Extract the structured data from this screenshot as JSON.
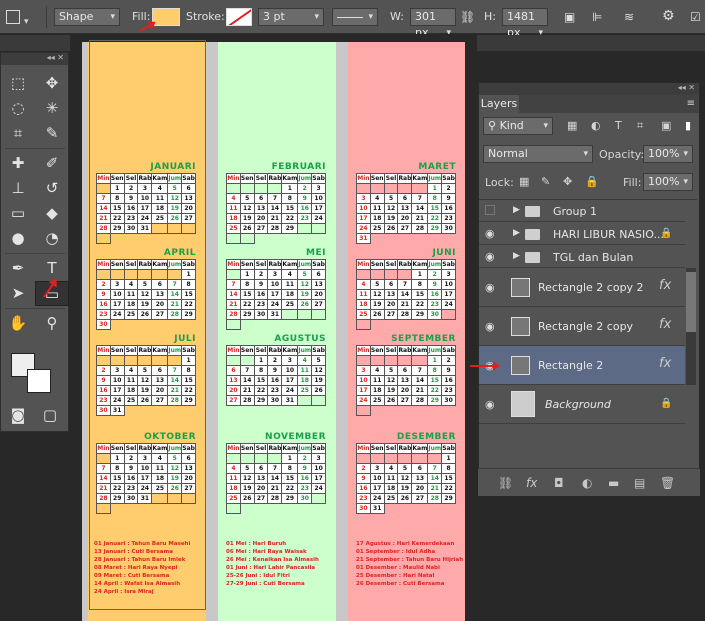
{
  "options_bar": {
    "mode": "Shape",
    "fill_label": "Fill:",
    "fill_color": "#ffcc6e",
    "stroke_label": "Stroke:",
    "stroke_width": "3 pt",
    "w_label": "W:",
    "w_value": "301 px",
    "h_label": "H:",
    "h_value": "1481 px"
  },
  "canvas": {
    "strip_colors": [
      "#ffcc6e",
      "#ccffcc",
      "#ffaaaa"
    ],
    "day_headers": [
      "Min",
      "Sen",
      "Sel",
      "Rab",
      "Kam",
      "Jum",
      "Sab"
    ],
    "months": [
      {
        "name": "JANUARI",
        "days": [
          "",
          "1",
          "2",
          "3",
          "4",
          "5",
          "6",
          "7",
          "8",
          "9",
          "10",
          "11",
          "12",
          "13",
          "14",
          "15",
          "16",
          "17",
          "18",
          "19",
          "20",
          "21",
          "22",
          "23",
          "24",
          "25",
          "26",
          "27",
          "28",
          "29",
          "30",
          "31",
          "",
          "",
          "",
          ""
        ]
      },
      {
        "name": "FEBRUARI",
        "days": [
          "",
          "",
          "",
          "",
          "1",
          "2",
          "3",
          "4",
          "5",
          "6",
          "7",
          "8",
          "9",
          "10",
          "11",
          "12",
          "13",
          "14",
          "15",
          "16",
          "17",
          "18",
          "19",
          "20",
          "21",
          "22",
          "23",
          "24",
          "25",
          "26",
          "27",
          "28",
          "29",
          "",
          "",
          "",
          ""
        ]
      },
      {
        "name": "MARET",
        "days": [
          "",
          "",
          "",
          "",
          "",
          "1",
          "2",
          "3",
          "4",
          "5",
          "6",
          "7",
          "8",
          "9",
          "10",
          "11",
          "12",
          "13",
          "14",
          "15",
          "16",
          "17",
          "18",
          "19",
          "20",
          "21",
          "22",
          "23",
          "24",
          "25",
          "26",
          "27",
          "28",
          "29",
          "30",
          "31"
        ]
      },
      {
        "name": "APRIL",
        "days": [
          "",
          "",
          "",
          "",
          "",
          "",
          "1",
          "2",
          "3",
          "4",
          "5",
          "6",
          "7",
          "8",
          "9",
          "10",
          "11",
          "12",
          "13",
          "14",
          "15",
          "16",
          "17",
          "18",
          "19",
          "20",
          "21",
          "22",
          "23",
          "24",
          "25",
          "26",
          "27",
          "28",
          "29",
          "30"
        ]
      },
      {
        "name": "MEI",
        "days": [
          "",
          "1",
          "2",
          "3",
          "4",
          "5",
          "6",
          "7",
          "8",
          "9",
          "10",
          "11",
          "12",
          "13",
          "14",
          "15",
          "16",
          "17",
          "18",
          "19",
          "20",
          "21",
          "22",
          "23",
          "24",
          "25",
          "26",
          "27",
          "28",
          "29",
          "30",
          "31",
          "",
          "",
          "",
          ""
        ]
      },
      {
        "name": "JUNI",
        "days": [
          "",
          "",
          "",
          "",
          "1",
          "2",
          "3",
          "4",
          "5",
          "6",
          "7",
          "8",
          "9",
          "10",
          "11",
          "12",
          "13",
          "14",
          "15",
          "16",
          "17",
          "18",
          "19",
          "20",
          "21",
          "22",
          "23",
          "24",
          "25",
          "26",
          "27",
          "28",
          "29",
          "30",
          "",
          ""
        ]
      },
      {
        "name": "JULI",
        "days": [
          "",
          "",
          "",
          "",
          "",
          "",
          "1",
          "2",
          "3",
          "4",
          "5",
          "6",
          "7",
          "8",
          "9",
          "10",
          "11",
          "12",
          "13",
          "14",
          "15",
          "16",
          "17",
          "18",
          "19",
          "20",
          "21",
          "22",
          "23",
          "24",
          "25",
          "26",
          "27",
          "28",
          "29",
          "30",
          "31"
        ]
      },
      {
        "name": "AGUSTUS",
        "days": [
          "",
          "",
          "1",
          "2",
          "3",
          "4",
          "5",
          "6",
          "7",
          "8",
          "9",
          "10",
          "11",
          "12",
          "13",
          "14",
          "15",
          "16",
          "17",
          "18",
          "19",
          "20",
          "21",
          "22",
          "23",
          "24",
          "25",
          "26",
          "27",
          "28",
          "29",
          "30",
          "31",
          "",
          ""
        ]
      },
      {
        "name": "SEPTEMBER",
        "days": [
          "",
          "",
          "",
          "",
          "",
          "1",
          "2",
          "3",
          "4",
          "5",
          "6",
          "7",
          "8",
          "9",
          "10",
          "11",
          "12",
          "13",
          "14",
          "15",
          "16",
          "17",
          "18",
          "19",
          "20",
          "21",
          "22",
          "23",
          "24",
          "25",
          "26",
          "27",
          "28",
          "29",
          "30",
          ""
        ]
      },
      {
        "name": "OKTOBER",
        "days": [
          "",
          "1",
          "2",
          "3",
          "4",
          "5",
          "6",
          "7",
          "8",
          "9",
          "10",
          "11",
          "12",
          "13",
          "14",
          "15",
          "16",
          "17",
          "18",
          "19",
          "20",
          "21",
          "22",
          "23",
          "24",
          "25",
          "26",
          "27",
          "28",
          "29",
          "30",
          "31",
          "",
          "",
          "",
          ""
        ]
      },
      {
        "name": "NOVEMBER",
        "days": [
          "",
          "",
          "",
          "",
          "1",
          "2",
          "3",
          "4",
          "5",
          "6",
          "7",
          "8",
          "9",
          "10",
          "11",
          "12",
          "13",
          "14",
          "15",
          "16",
          "17",
          "18",
          "19",
          "20",
          "21",
          "22",
          "23",
          "24",
          "25",
          "26",
          "27",
          "28",
          "29",
          "30",
          "",
          ""
        ]
      },
      {
        "name": "DESEMBER",
        "days": [
          "",
          "",
          "",
          "",
          "",
          "",
          "1",
          "2",
          "3",
          "4",
          "5",
          "6",
          "7",
          "8",
          "9",
          "10",
          "11",
          "12",
          "13",
          "14",
          "15",
          "16",
          "17",
          "18",
          "19",
          "20",
          "21",
          "22",
          "23",
          "24",
          "25",
          "26",
          "27",
          "28",
          "29",
          "30",
          "31"
        ]
      }
    ],
    "holidays": [
      "01 Januari : Tahun Baru Masehi\n13 Januari : Cuti Bersama\n28 Januari : Tahun Baru Imlek\n08 Maret : Hari Raya Nyepi\n09 Maret : Cuti Bersama\n14 April : Wafat Isa Almasih\n24 April : Isra Miraj",
      "01 Mei : Hari Buruh\n06 Mei : Hari Raya Waisak\n26 Mei : Kenaikan Isa Almasih\n01 Juni : Hari Lahir Pancasila\n25-26 Juni : Idul Fitri\n27-29 Juni : Cuti Bersama",
      "17 Agustus : Hari Kemerdekaan\n01 September : Idul Adha\n21 September : Tahun Baru Hijriah\n01 Desember : Maulid Nabi\n25 Desember : Hari Natal\n26 Desember : Cuti Bersama"
    ]
  },
  "layers_panel": {
    "title": "Layers",
    "filter": "Kind",
    "blend_mode": "Normal",
    "opacity_label": "Opacity:",
    "opacity_value": "100%",
    "lock_label": "Lock:",
    "fill_label": "Fill:",
    "fill_value": "100%",
    "layers": [
      {
        "name": "Group 1",
        "type": "folder",
        "visible": false
      },
      {
        "name": "HARI LIBUR NASIO...",
        "type": "folder",
        "visible": true,
        "locked": true
      },
      {
        "name": "TGL dan Bulan",
        "type": "folder",
        "visible": true
      },
      {
        "name": "Rectangle 2 copy 2",
        "type": "shape",
        "visible": true
      },
      {
        "name": "Rectangle 2 copy",
        "type": "shape",
        "visible": true
      },
      {
        "name": "Rectangle 2",
        "type": "shape",
        "visible": true,
        "selected": true
      },
      {
        "name": "Background",
        "type": "background",
        "visible": true,
        "locked": true
      }
    ]
  }
}
